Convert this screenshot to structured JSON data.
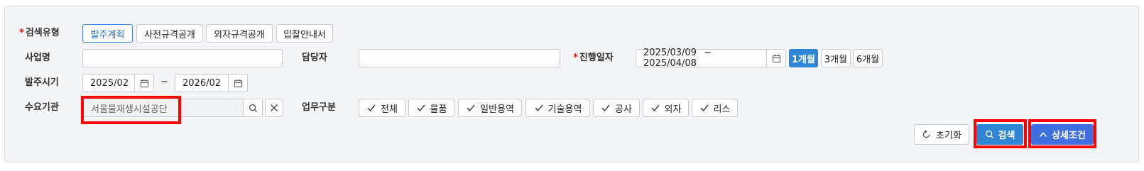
{
  "search_type": {
    "label": "검색유형",
    "required_mark": "*",
    "options": [
      "발주계획",
      "사전규격공개",
      "외자규격공개",
      "입찰안내서"
    ],
    "selected": "발주계획"
  },
  "business_name": {
    "label": "사업명",
    "value": ""
  },
  "manager": {
    "label": "담당자",
    "value": ""
  },
  "progress_date": {
    "label": "진행일자",
    "required_mark": "*",
    "start": "2025/03/09",
    "separator": "~",
    "end": "2025/04/08",
    "periods": [
      "1개월",
      "3개월",
      "6개월"
    ],
    "selected_period": "1개월"
  },
  "order_period": {
    "label": "발주시기",
    "start": "2025/02",
    "separator": "~",
    "end": "2026/02"
  },
  "demand_agency": {
    "label": "수요기관",
    "value": "서울물재생시설공단"
  },
  "business_type": {
    "label": "업무구분",
    "options": [
      "전체",
      "물품",
      "일반용역",
      "기술용역",
      "공사",
      "외자",
      "리스"
    ]
  },
  "actions": {
    "reset_label": "초기화",
    "search_label": "검색",
    "detail_label": "상세조건"
  },
  "colors": {
    "primary": "#2f86d6",
    "detail": "#3f6fe0",
    "highlight": "#ff0000",
    "required": "#e02020"
  }
}
